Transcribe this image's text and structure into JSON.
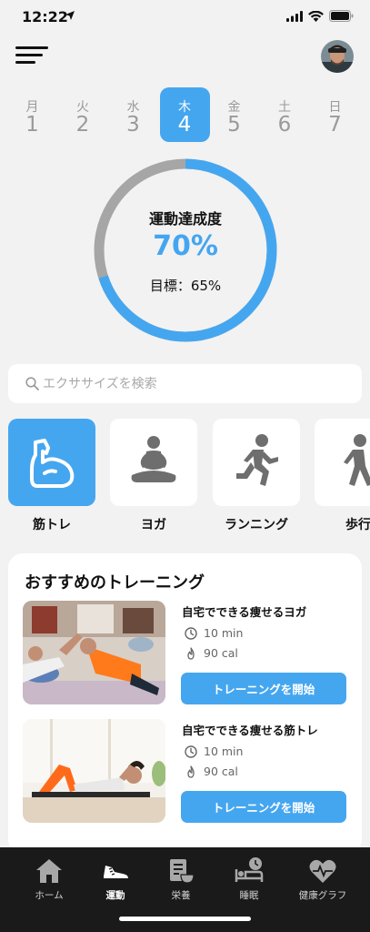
{
  "status": {
    "time": "12:22"
  },
  "week": [
    {
      "dow": "月",
      "day": "1"
    },
    {
      "dow": "火",
      "day": "2"
    },
    {
      "dow": "水",
      "day": "3"
    },
    {
      "dow": "木",
      "day": "4"
    },
    {
      "dow": "金",
      "day": "5"
    },
    {
      "dow": "土",
      "day": "6"
    },
    {
      "dow": "日",
      "day": "7"
    }
  ],
  "progress": {
    "title": "運動達成度",
    "value": "70%",
    "fraction": 0.7,
    "target": "目標：65%"
  },
  "search": {
    "placeholder": "エクササイズを検索"
  },
  "categories": [
    {
      "label": "筋トレ",
      "icon": "muscle-arm-icon"
    },
    {
      "label": "ヨガ",
      "icon": "yoga-icon"
    },
    {
      "label": "ランニング",
      "icon": "running-icon"
    },
    {
      "label": "歩行",
      "icon": "walking-icon"
    }
  ],
  "recommended": {
    "title": "おすすめのトレーニング",
    "items": [
      {
        "title": "自宅でできる痩せるヨガ",
        "duration": "10 min",
        "calories": "90 cal",
        "button": "トレーニングを開始"
      },
      {
        "title": "自宅でできる痩せる筋トレ",
        "duration": "10 min",
        "calories": "90 cal",
        "button": "トレーニングを開始"
      }
    ]
  },
  "tabs": [
    {
      "label": "ホーム",
      "icon": "home-icon"
    },
    {
      "label": "運動",
      "icon": "sneaker-icon"
    },
    {
      "label": "栄養",
      "icon": "nutrition-icon"
    },
    {
      "label": "睡眠",
      "icon": "sleep-icon"
    },
    {
      "label": "健康グラフ",
      "icon": "health-graph-icon"
    }
  ],
  "colors": {
    "accent": "#45a6f0",
    "ring_track": "#a6a6a6",
    "tabbar": "#1a1a1a"
  }
}
